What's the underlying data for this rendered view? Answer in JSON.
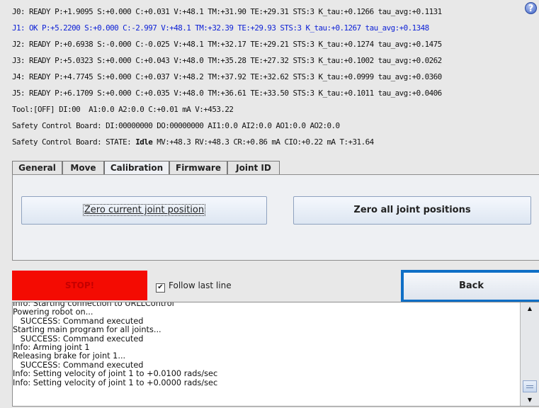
{
  "status": {
    "lines": [
      {
        "text": "J0: READY P:+1.9095 S:+0.000 C:+0.031 V:+48.1 TM:+31.90 TE:+29.31 STS:3 K_tau:+0.1266 tau_avg:+0.1131",
        "color": "#111111"
      },
      {
        "text": "J1: OK P:+5.2200 S:+0.000 C:-2.997 V:+48.1 TM:+32.39 TE:+29.93 STS:3 K_tau:+0.1267 tau_avg:+0.1348",
        "color": "#0b1fd6"
      },
      {
        "text": "J2: READY P:+0.6938 S:-0.000 C:-0.025 V:+48.1 TM:+32.17 TE:+29.21 STS:3 K_tau:+0.1274 tau_avg:+0.1475",
        "color": "#111111"
      },
      {
        "text": "J3: READY P:+5.0323 S:+0.000 C:+0.043 V:+48.0 TM:+35.28 TE:+27.32 STS:3 K_tau:+0.1002 tau_avg:+0.0262",
        "color": "#111111"
      },
      {
        "text": "J4: READY P:+4.7745 S:+0.000 C:+0.037 V:+48.2 TM:+37.92 TE:+32.62 STS:3 K_tau:+0.0999 tau_avg:+0.0360",
        "color": "#111111"
      },
      {
        "text": "J5: READY P:+6.1709 S:+0.000 C:+0.035 V:+48.0 TM:+36.61 TE:+33.50 STS:3 K_tau:+0.1011 tau_avg:+0.0406",
        "color": "#111111"
      },
      {
        "text": "Tool:[OFF] DI:00  A1:0.0 A2:0.0 C:+0.01 mA V:+453.22",
        "color": "#111111"
      },
      {
        "text": "Safety Control Board: DI:00000000 DO:00000000 AI1:0.0 AI2:0.0 AO1:0.0 AO2:0.0",
        "color": "#111111"
      }
    ],
    "safety_state_prefix": "Safety Control Board: STATE: ",
    "safety_state_value": "Idle",
    "safety_state_suffix": " MV:+48.3 RV:+48.3 CR:+0.86 mA CIO:+0.22 mA T:+31.64"
  },
  "help_icon": {
    "glyph": "?",
    "name": "help-icon"
  },
  "tabs": [
    {
      "label": "General",
      "active": false
    },
    {
      "label": "Move",
      "active": false
    },
    {
      "label": "Calibration",
      "active": true
    },
    {
      "label": "Firmware",
      "active": false
    },
    {
      "label": "Joint ID",
      "active": false
    }
  ],
  "calibration": {
    "zero_current_label": "Zero current joint position",
    "zero_all_label": "Zero all joint positions"
  },
  "controls": {
    "stop_label": "STOP!",
    "follow_label": "Follow last line",
    "follow_checked": true,
    "follow_check_glyph": "✔",
    "back_label": "Back"
  },
  "log": {
    "lines": [
      "Info: Starting connection to URLLControl",
      "Powering robot on...",
      "   SUCCESS: Command executed",
      "Starting main program for all joints...",
      "   SUCCESS: Command executed",
      "Info: Arming joint 1",
      "Releasing brake for joint 1...",
      "   SUCCESS: Command executed",
      "Info: Setting velocity of joint 1 to +0.0100 rads/sec",
      "Info: Setting velocity of joint 1 to +0.0000 rads/sec"
    ],
    "scroll_up_glyph": "▲",
    "scroll_down_glyph": "▼"
  },
  "colors": {
    "stop_red": "#f40b02",
    "focus_blue": "#0f6fc6",
    "active_joint_blue": "#0b1fd6"
  }
}
